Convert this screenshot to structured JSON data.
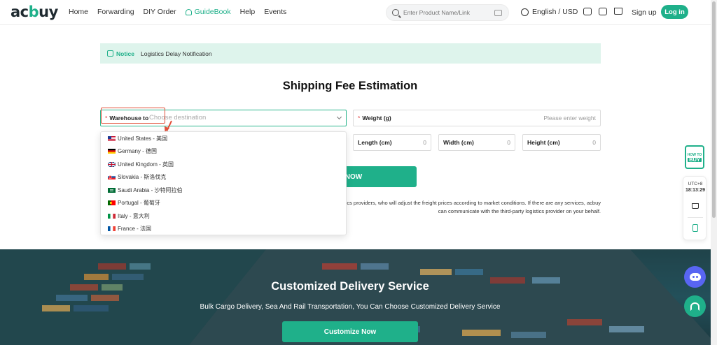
{
  "header": {
    "logo": {
      "pre": "ac",
      "accent": "b",
      "post": "uy"
    },
    "nav": [
      "Home",
      "Forwarding",
      "DIY Order",
      "GuideBook",
      "Help",
      "Events"
    ],
    "active_nav": "GuideBook",
    "search_placeholder": "Enter Product Name/Link",
    "language": "English / USD",
    "signup": "Sign up",
    "login": "Log in"
  },
  "notice": {
    "label": "Notice",
    "text": "Logistics Delay Notification"
  },
  "page_title": "Shipping Fee Estimation",
  "form": {
    "warehouse_label": "Warehouse to",
    "warehouse_placeholder": "Choose destination",
    "weight_label": "Weight (g)",
    "weight_placeholder": "Please enter weight",
    "length_label": "Length (cm)",
    "width_label": "Width (cm)",
    "height_label": "Height (cm)",
    "length_value": "0",
    "width_value": "0",
    "height_value": "0",
    "check_button": "K NOW"
  },
  "disclaimer": "ics providers, who will adjust the freight prices according to market conditions. If there are any services, acbuy can communicate with the third-party logistics provider on your behalf.",
  "dropdown": [
    "United States - 美国",
    "Germany - 德国",
    "United Kingdom - 英国",
    "Slovakia - 斯洛伐克",
    "Saudi Arabia - 沙特阿拉伯",
    "Portugal - 葡萄牙",
    "Italy - 意大利",
    "France - 法国"
  ],
  "hero": {
    "title": "Customized Delivery Service",
    "subtitle": "Bulk Cargo Delivery, Sea And Rail Transportation, You Can Choose Customized Delivery Service",
    "button": "Customize Now"
  },
  "side": {
    "howto_top": "HOW TO",
    "howto_big": "BUY",
    "utc_label": "UTC+8",
    "time": "18:13:29"
  },
  "colors": {
    "brand": "#1fb08a",
    "highlight": "#e2513b",
    "discord": "#5865f2"
  }
}
